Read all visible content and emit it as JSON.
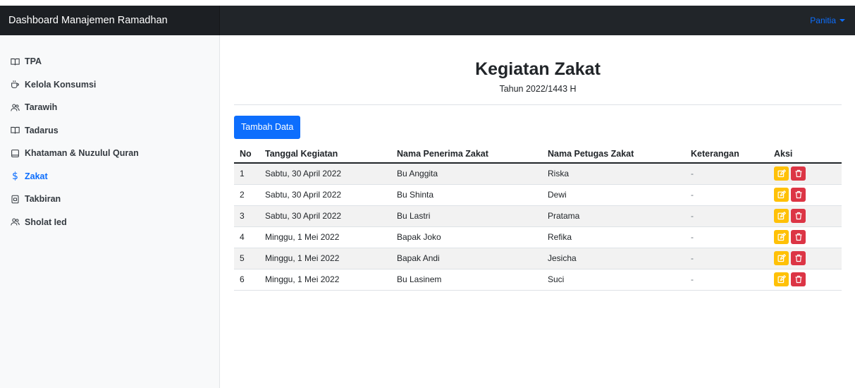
{
  "navbar": {
    "brand": "Dashboard Manajemen Ramadhan",
    "user_menu": "Panitia"
  },
  "sidebar": {
    "items": [
      {
        "label": "TPA",
        "icon": "book-icon"
      },
      {
        "label": "Kelola Konsumsi",
        "icon": "cup-icon"
      },
      {
        "label": "Tarawih",
        "icon": "people-icon"
      },
      {
        "label": "Tadarus",
        "icon": "book-icon"
      },
      {
        "label": "Khataman & Nuzulul Quran",
        "icon": "square-icon"
      },
      {
        "label": "Zakat",
        "icon": "dollar-icon",
        "active": true
      },
      {
        "label": "Takbiran",
        "icon": "file-icon"
      },
      {
        "label": "Sholat Ied",
        "icon": "people-icon"
      }
    ]
  },
  "page": {
    "title": "Kegiatan Zakat",
    "subtitle": "Tahun 2022/1443 H",
    "add_button": "Tambah Data"
  },
  "table": {
    "headers": [
      "No",
      "Tanggal Kegiatan",
      "Nama Penerima Zakat",
      "Nama Petugas Zakat",
      "Keterangan",
      "Aksi"
    ],
    "rows": [
      [
        "1",
        "Sabtu, 30 April 2022",
        "Bu Anggita",
        "Riska",
        "-"
      ],
      [
        "2",
        "Sabtu, 30 April 2022",
        "Bu Shinta",
        "Dewi",
        "-"
      ],
      [
        "3",
        "Sabtu, 30 April 2022",
        "Bu Lastri",
        "Pratama",
        "-"
      ],
      [
        "4",
        "Minggu, 1 Mei 2022",
        "Bapak Joko",
        "Refika",
        "-"
      ],
      [
        "5",
        "Minggu, 1 Mei 2022",
        "Bapak Andi",
        "Jesicha",
        "-"
      ],
      [
        "6",
        "Minggu, 1 Mei 2022",
        "Bu Lasinem",
        "Suci",
        "-"
      ]
    ]
  },
  "colors": {
    "primary": "#0d6efd",
    "warning": "#ffc107",
    "danger": "#dc3545",
    "navbar": "#212529"
  }
}
